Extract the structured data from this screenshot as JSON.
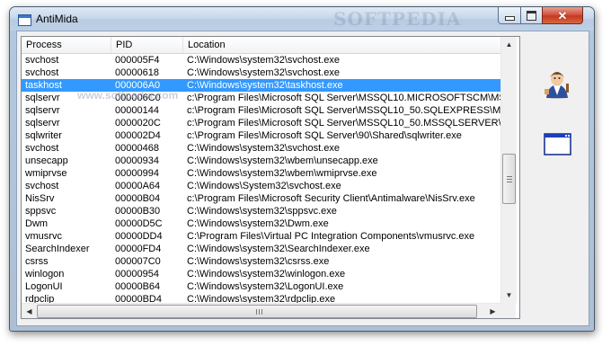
{
  "window": {
    "title": "AntiMida"
  },
  "watermark": "SOFTPEDIA",
  "list_watermark": "www.softpedia.com",
  "columns": [
    "Process",
    "PID",
    "Location"
  ],
  "rows": [
    {
      "process": "svchost",
      "pid": "000005F4",
      "location": "C:\\Windows\\system32\\svchost.exe"
    },
    {
      "process": "svchost",
      "pid": "00000618",
      "location": "C:\\Windows\\system32\\svchost.exe"
    },
    {
      "process": "taskhost",
      "pid": "000006A0",
      "location": "C:\\Windows\\system32\\taskhost.exe",
      "selected": true
    },
    {
      "process": "sqlservr",
      "pid": "000006C0",
      "location": "c:\\Program Files\\Microsoft SQL Server\\MSSQL10.MICROSOFTSCM\\MSS..."
    },
    {
      "process": "sqlservr",
      "pid": "00000144",
      "location": "c:\\Program Files\\Microsoft SQL Server\\MSSQL10_50.SQLEXPRESS\\MSSQ..."
    },
    {
      "process": "sqlservr",
      "pid": "0000020C",
      "location": "c:\\Program Files\\Microsoft SQL Server\\MSSQL10_50.MSSQLSERVER\\MS..."
    },
    {
      "process": "sqlwriter",
      "pid": "000002D4",
      "location": "c:\\Program Files\\Microsoft SQL Server\\90\\Shared\\sqlwriter.exe"
    },
    {
      "process": "svchost",
      "pid": "00000468",
      "location": "C:\\Windows\\system32\\svchost.exe"
    },
    {
      "process": "unsecapp",
      "pid": "00000934",
      "location": "C:\\Windows\\system32\\wbem\\unsecapp.exe"
    },
    {
      "process": "wmiprvse",
      "pid": "00000994",
      "location": "C:\\Windows\\system32\\wbem\\wmiprvse.exe"
    },
    {
      "process": "svchost",
      "pid": "00000A64",
      "location": "C:\\Windows\\System32\\svchost.exe"
    },
    {
      "process": "NisSrv",
      "pid": "00000B04",
      "location": "c:\\Program Files\\Microsoft Security Client\\Antimalware\\NisSrv.exe"
    },
    {
      "process": "sppsvc",
      "pid": "00000B30",
      "location": "C:\\Windows\\system32\\sppsvc.exe"
    },
    {
      "process": "Dwm",
      "pid": "00000D5C",
      "location": "C:\\Windows\\system32\\Dwm.exe"
    },
    {
      "process": "vmusrvc",
      "pid": "00000DD4",
      "location": "C:\\Program Files\\Virtual PC Integration Components\\vmusrvc.exe"
    },
    {
      "process": "SearchIndexer",
      "pid": "00000FD4",
      "location": "C:\\Windows\\system32\\SearchIndexer.exe"
    },
    {
      "process": "csrss",
      "pid": "000007C0",
      "location": "C:\\Windows\\system32\\csrss.exe"
    },
    {
      "process": "winlogon",
      "pid": "00000954",
      "location": "C:\\Windows\\system32\\winlogon.exe"
    },
    {
      "process": "LogonUI",
      "pid": "00000B64",
      "location": "C:\\Windows\\system32\\LogonUI.exe"
    },
    {
      "process": "rdpclip",
      "pid": "00000BD4",
      "location": "C:\\Windows\\system32\\rdpclip.exe"
    }
  ],
  "colors": {
    "selection": "#3399ff",
    "window_frame": "#b3c8df",
    "close_button": "#c23a22"
  },
  "icons": {
    "app": "window-icon",
    "side_top": "wizard-icon",
    "side_bottom": "window-icon"
  }
}
